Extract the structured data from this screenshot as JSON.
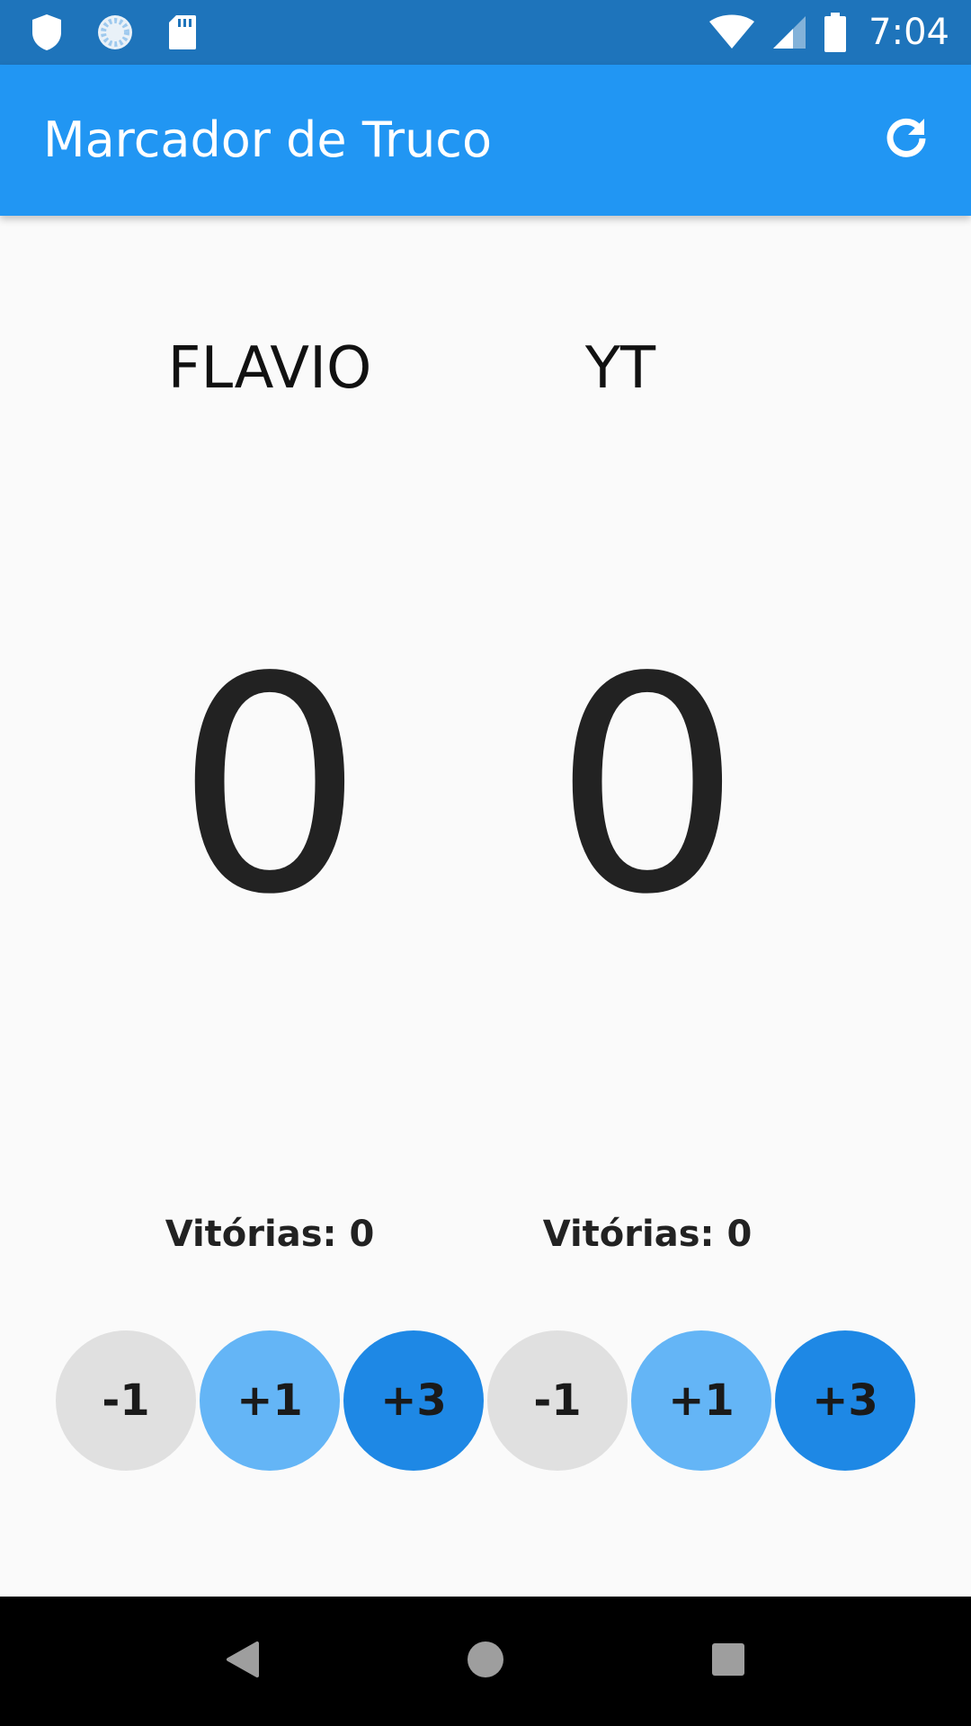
{
  "status_bar": {
    "time": "7:04",
    "icons": [
      "shield-icon",
      "sync-icon",
      "sd-card-icon",
      "wifi-icon",
      "signal-icon",
      "battery-icon"
    ]
  },
  "app_bar": {
    "title": "Marcador de Truco",
    "action_icon": "refresh-icon",
    "color": "#2196f3"
  },
  "players": [
    {
      "name": "FLAVIO",
      "score": "0",
      "wins_label": "Vitórias:",
      "wins_value": "0",
      "buttons": [
        "-1",
        "+1",
        "+3"
      ]
    },
    {
      "name": "YT",
      "score": "0",
      "wins_label": "Vitórias:",
      "wins_value": "0",
      "buttons": [
        "-1",
        "+1",
        "+3"
      ]
    }
  ],
  "colors": {
    "status_bar": "#1e74bb",
    "minus_button": "#e0e0e0",
    "plus1_button": "#64b5f6",
    "plus3_button": "#1e88e5",
    "background": "#fafafa"
  },
  "nav_bar": {
    "icons": [
      "back-icon",
      "home-icon",
      "recents-icon"
    ]
  }
}
